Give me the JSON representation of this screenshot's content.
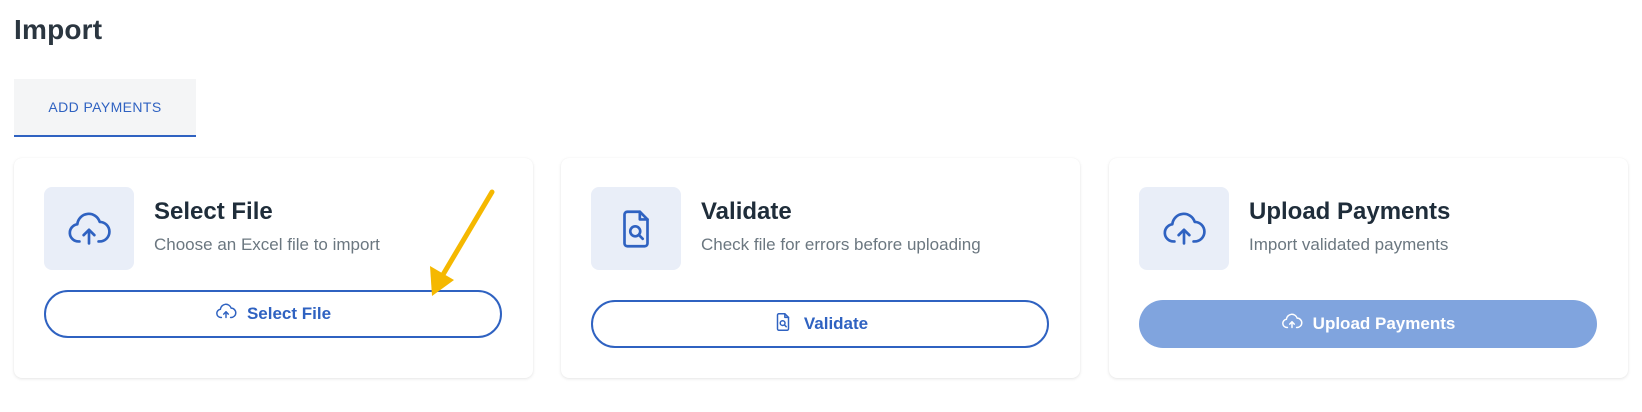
{
  "page": {
    "title": "Import"
  },
  "tabs": [
    {
      "label": "ADD PAYMENTS",
      "active": true
    }
  ],
  "steps": [
    {
      "title": "Select File",
      "subtitle": "Choose an Excel file to import",
      "icon": "cloud-upload-icon",
      "button_label": "Select File",
      "button_icon": "cloud-upload-icon",
      "button_style": "outline"
    },
    {
      "title": "Validate",
      "subtitle": "Check file for errors before uploading",
      "icon": "file-search-icon",
      "button_label": "Validate",
      "button_icon": "file-search-icon",
      "button_style": "outline"
    },
    {
      "title": "Upload Payments",
      "subtitle": "Import validated payments",
      "icon": "cloud-upload-icon",
      "button_label": "Upload Payments",
      "button_icon": "cloud-upload-icon",
      "button_style": "filled-disabled"
    }
  ],
  "annotation": {
    "type": "arrow",
    "color": "#f5b800",
    "points_to": "select-file-button"
  },
  "colors": {
    "accent": "#2f62c1",
    "icon_bg": "#e9eef8",
    "disabled_button": "#80a4de",
    "text_primary": "#1f2d3a",
    "text_secondary": "#6b7780"
  }
}
